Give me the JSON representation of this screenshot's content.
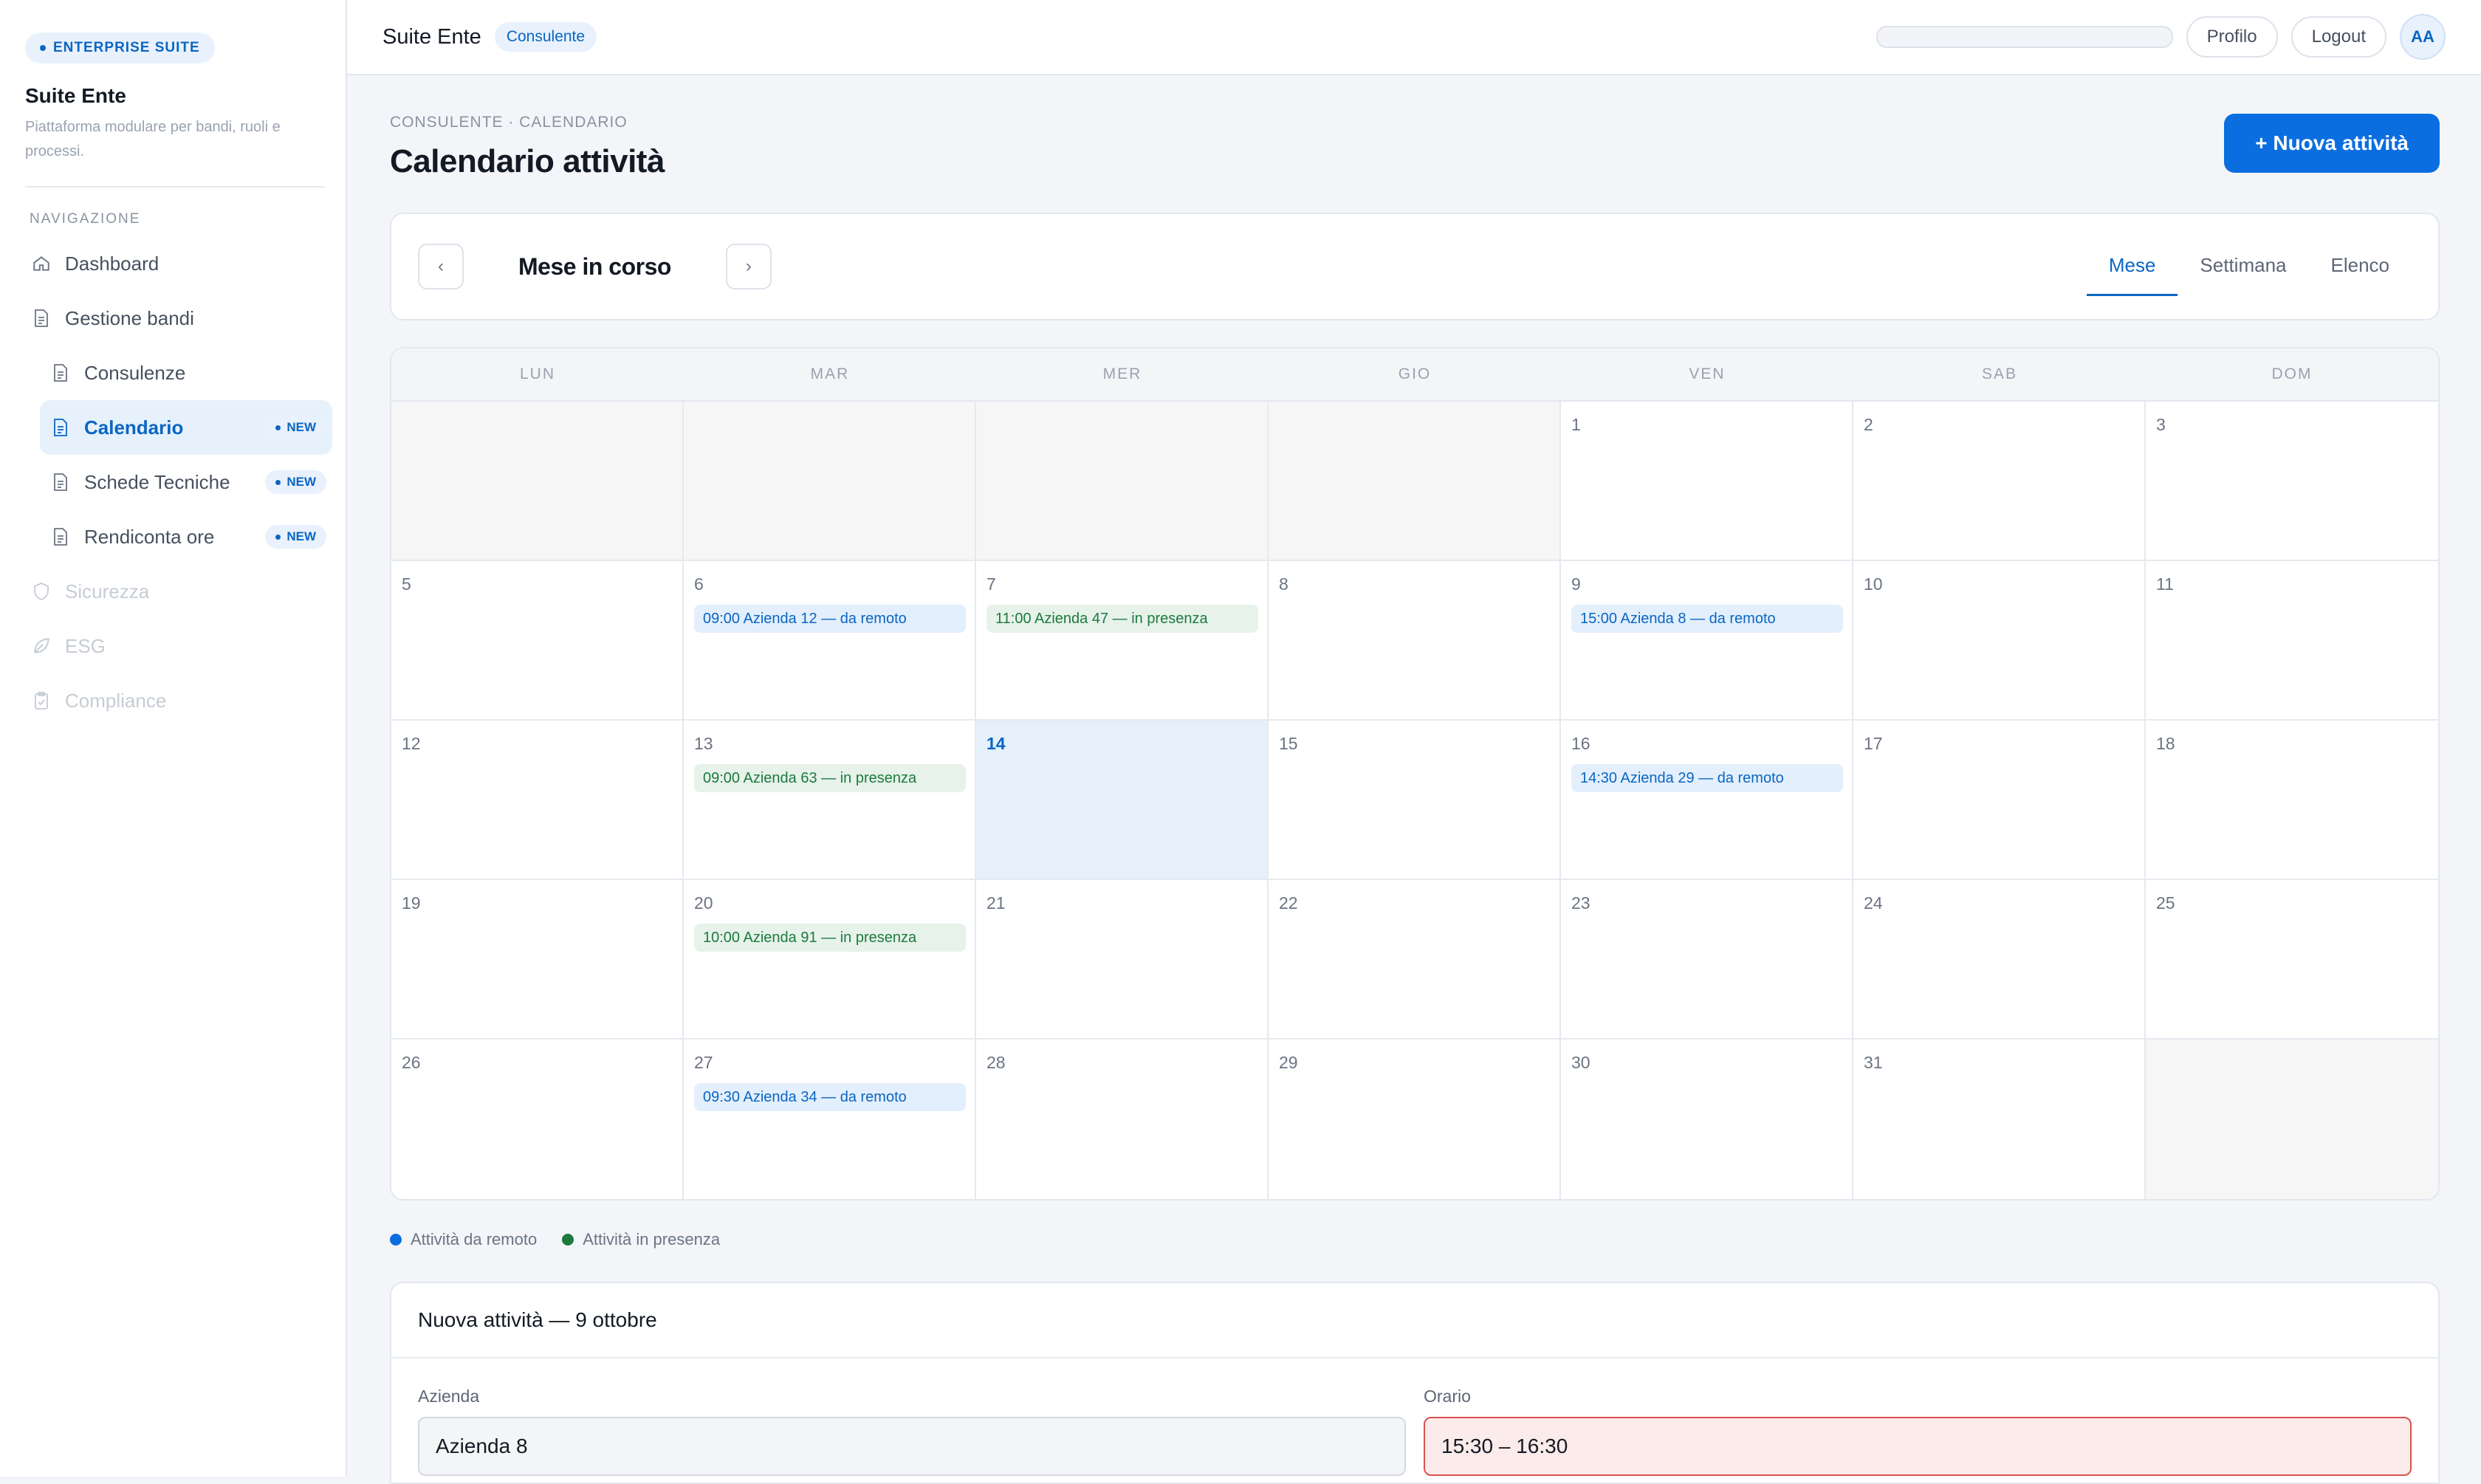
{
  "sidebar": {
    "brand_badge": "ENTERPRISE SUITE",
    "brand_title": "Suite Ente",
    "brand_subtitle": "Piattaforma modulare per bandi, ruoli e processi.",
    "nav_title": "NAVIGAZIONE",
    "items": [
      {
        "label": "Dashboard",
        "icon": "home-icon"
      },
      {
        "label": "Gestione bandi",
        "icon": "document-icon"
      },
      {
        "label": "Consulenze",
        "icon": "document-icon"
      },
      {
        "label": "Calendario",
        "icon": "document-icon",
        "badge": "NEW",
        "active": true
      },
      {
        "label": "Schede Tecniche",
        "icon": "document-icon",
        "badge": "NEW"
      },
      {
        "label": "Rendiconta ore",
        "icon": "document-icon",
        "badge": "NEW"
      },
      {
        "label": "Sicurezza",
        "icon": "shield-icon",
        "disabled": true
      },
      {
        "label": "ESG",
        "icon": "leaf-icon",
        "disabled": true
      },
      {
        "label": "Compliance",
        "icon": "clipboard-icon",
        "disabled": true
      }
    ]
  },
  "topbar": {
    "title": "Suite Ente",
    "role": "Consulente",
    "profile_label": "Profilo",
    "logout_label": "Logout",
    "avatar_initials": "AA"
  },
  "page": {
    "breadcrumb": "CONSULENTE · CALENDARIO",
    "title": "Calendario attività",
    "new_button": "+ Nuova attività"
  },
  "toolbar": {
    "prev_label": "‹",
    "next_label": "›",
    "period": "Mese in corso",
    "tabs": [
      "Mese",
      "Settimana",
      "Elenco"
    ],
    "active_tab": "Mese"
  },
  "calendar": {
    "weekdays": [
      "LUN",
      "MAR",
      "MER",
      "GIO",
      "VEN",
      "SAB",
      "DOM"
    ],
    "today": "14",
    "weeks": [
      [
        {
          "d": ""
        },
        {
          "d": ""
        },
        {
          "d": ""
        },
        {
          "d": ""
        },
        {
          "d": "1"
        },
        {
          "d": "2"
        },
        {
          "d": "3"
        }
      ],
      [
        {
          "d": "5"
        },
        {
          "d": "6",
          "events": [
            {
              "text": "09:00 Azienda 12 — da remoto",
              "type": "remote"
            }
          ]
        },
        {
          "d": "7",
          "events": [
            {
              "text": "11:00 Azienda 47 — in presenza",
              "type": "onsite"
            }
          ]
        },
        {
          "d": "8"
        },
        {
          "d": "9",
          "events": [
            {
              "text": "15:00 Azienda 8 — da remoto",
              "type": "remote"
            }
          ]
        },
        {
          "d": "10"
        },
        {
          "d": "11"
        }
      ],
      [
        {
          "d": "12"
        },
        {
          "d": "13",
          "events": [
            {
              "text": "09:00 Azienda 63 — in presenza",
              "type": "onsite"
            }
          ]
        },
        {
          "d": "14"
        },
        {
          "d": "15"
        },
        {
          "d": "16",
          "events": [
            {
              "text": "14:30 Azienda 29 — da remoto",
              "type": "remote"
            }
          ]
        },
        {
          "d": "17"
        },
        {
          "d": "18"
        }
      ],
      [
        {
          "d": "19"
        },
        {
          "d": "20",
          "events": [
            {
              "text": "10:00 Azienda 91 — in presenza",
              "type": "onsite"
            }
          ]
        },
        {
          "d": "21"
        },
        {
          "d": "22"
        },
        {
          "d": "23"
        },
        {
          "d": "24"
        },
        {
          "d": "25"
        }
      ],
      [
        {
          "d": "26"
        },
        {
          "d": "27",
          "events": [
            {
              "text": "09:30 Azienda 34 — da remoto",
              "type": "remote"
            }
          ]
        },
        {
          "d": "28"
        },
        {
          "d": "29"
        },
        {
          "d": "30"
        },
        {
          "d": "31"
        },
        {
          "d": ""
        }
      ]
    ]
  },
  "legend": [
    {
      "label": "Attività da remoto",
      "color": "#0a6ee0"
    },
    {
      "label": "Attività in presenza",
      "color": "#1d7a3e"
    }
  ],
  "form": {
    "title": "Nuova attività — 9 ottobre",
    "company_label": "Azienda",
    "company_value": "Azienda 8",
    "time_label": "Orario",
    "time_value": "15:30 – 16:30"
  },
  "colors": {
    "accent": "#0a66c2",
    "primary_button": "#0a6ee0",
    "remote_event_bg": "#e3effc",
    "onsite_event_bg": "#e6f2ea",
    "error_field_bg": "#fbebea"
  }
}
